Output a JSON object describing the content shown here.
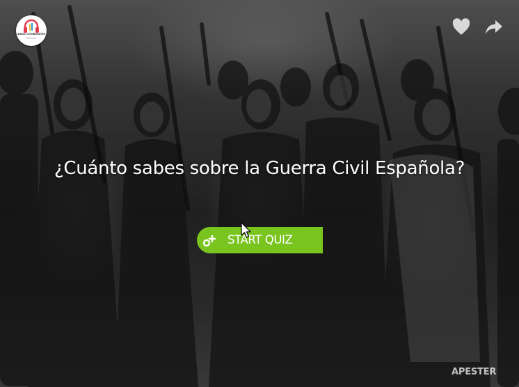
{
  "quiz": {
    "title": "¿Cuánto sabes sobre la Guerra Civil Española?",
    "start_label": "START QUIZ"
  },
  "header": {
    "logo_text": "IDEAS COMBINATES",
    "logo_subtext": "PODCAST",
    "heart_icon": "heart-icon",
    "share_icon": "share-icon"
  },
  "footer": {
    "brand": "APESTER"
  },
  "colors": {
    "start_button": "#7ac41f",
    "text": "#ffffff",
    "overlay_icons": "#d9d9d9"
  }
}
